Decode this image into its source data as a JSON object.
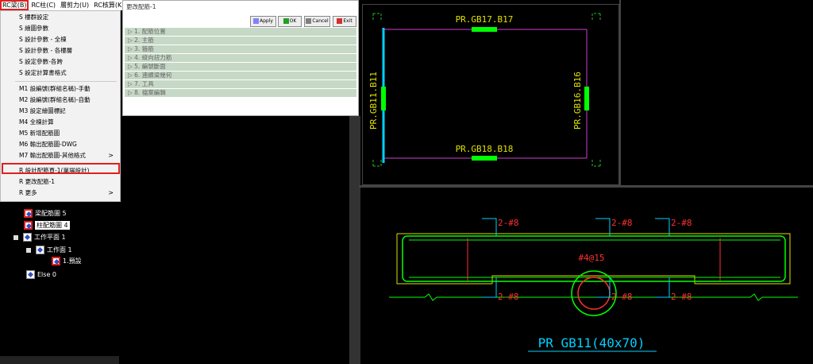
{
  "menubar": {
    "items": [
      {
        "label": "RC梁(B)",
        "active": true
      },
      {
        "label": "RC柱(C)",
        "active": false
      },
      {
        "label": "層剪力(U)",
        "active": false
      },
      {
        "label": "RC核算(K",
        "active": false
      }
    ]
  },
  "dropdown": {
    "items": [
      {
        "label": "S 樓群設定",
        "submenu": false
      },
      {
        "label": "S 繪圖參數",
        "submenu": false
      },
      {
        "label": "S 設計參數 - 全棟",
        "submenu": false
      },
      {
        "label": "S 設計參數 - 各樓層",
        "submenu": false
      },
      {
        "label": "S 設定參數-各跨",
        "submenu": false
      },
      {
        "label": "S 設定計算書格式",
        "submenu": false
      },
      {
        "label": "M1 設編號(群組名稱)-手動",
        "submenu": false
      },
      {
        "label": "M2 設編號(群組名稱)-自動",
        "submenu": false
      },
      {
        "label": "M3 設定繪圖標記",
        "submenu": false
      },
      {
        "label": "M4 全棟計算",
        "submenu": false
      },
      {
        "label": "M5 新增配筋圖",
        "submenu": false
      },
      {
        "label": "M6 輸出配筋圖-DWG",
        "submenu": false
      },
      {
        "label": "M7 輸出配筋圖-其他格式",
        "submenu": true
      },
      {
        "label": "R 設計配筋頁-1(單場設計)",
        "submenu": false
      },
      {
        "label": "R 更改配筋-1",
        "submenu": false,
        "highlighted": true
      },
      {
        "label": "R 更多",
        "submenu": true
      }
    ],
    "submenu_arrow": ">"
  },
  "tree": {
    "items": [
      {
        "label": "梁配筋圖 5",
        "icon": "beam-rebar-icon",
        "boxed": false
      },
      {
        "label": "柱配筋圖 4",
        "icon": "column-rebar-icon",
        "boxed": true
      },
      {
        "label": "工作平面 1",
        "icon": "workplane-icon",
        "boxed": false
      },
      {
        "label": "工作面 1",
        "icon": "workface-icon",
        "boxed": false
      },
      {
        "label": "1.預設",
        "icon": "default-icon",
        "boxed": false
      },
      {
        "label": "Else 0",
        "icon": "else-icon",
        "boxed": false
      }
    ]
  },
  "panel": {
    "title": "更改配筋-1",
    "buttons": [
      {
        "label": "Apply",
        "icon": "apply-icon"
      },
      {
        "label": "OK",
        "icon": "check-icon"
      },
      {
        "label": "Cancel",
        "icon": "cancel-icon"
      },
      {
        "label": "Exit",
        "icon": "exit-icon"
      }
    ],
    "sections": [
      "▷ 1. 配筋位置",
      "▷ 2. 主筋",
      "▷ 3. 箍筋",
      "▷ 4. 縱向扭力筋",
      "▷ 5. 編號斷面",
      "▷ 6. 連續梁幾何",
      "▷ 7. 工具",
      "▷ 8. 檔案編輯"
    ]
  },
  "drawing_top": {
    "beam_top": "PR.GB17.B17",
    "beam_bottom": "PR.GB18.B18",
    "beam_left": "PR.GB11.B11",
    "beam_right": "PR.GB16.B16"
  },
  "drawing_bottom": {
    "rebar_top_left": "2-#8",
    "rebar_top_mid": "2-#8",
    "rebar_top_right": "2-#8",
    "rebar_bot_left": "2-#8",
    "rebar_bot_mid": "2-#8",
    "rebar_bot_right": "2-#8",
    "stirrup": "#4@15",
    "section_title": "PR GB11(40x70)"
  },
  "colors": {
    "highlight_red": "#e02020",
    "panel_section": "#c6d8c6",
    "cad_green": "#00ff00",
    "cad_magenta": "#d040d0",
    "cad_yellow": "#e0e000",
    "cad_cyan": "#00d0ff",
    "cad_red": "#ff3030"
  }
}
